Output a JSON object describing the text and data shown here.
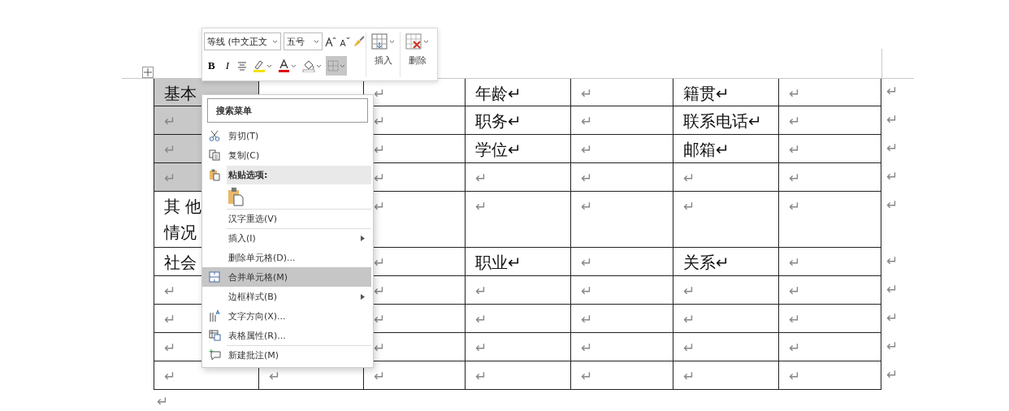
{
  "toolbar": {
    "font_name": "等线 (中文正文",
    "font_size": "五号",
    "format_buttons": [
      {
        "kind": "bold",
        "label": "B",
        "selected": false
      },
      {
        "kind": "italic",
        "label": "I",
        "selected": false
      },
      {
        "kind": "center",
        "selected": false
      },
      {
        "kind": "highlight",
        "selected": false
      },
      {
        "kind": "font-color",
        "selected": false
      },
      {
        "kind": "shading",
        "selected": false
      },
      {
        "kind": "borders",
        "selected": true
      }
    ],
    "table_buttons": [
      {
        "kind": "insert",
        "label": "插入"
      },
      {
        "kind": "delete",
        "label": "删除"
      }
    ]
  },
  "context_menu": {
    "search_placeholder": "搜索菜单",
    "items": [
      {
        "kind": "command",
        "label": "剪切(T)",
        "selected": false,
        "divider_above": false
      },
      {
        "kind": "command",
        "label": "复制(C)",
        "selected": false,
        "divider_above": false
      },
      {
        "kind": "heading",
        "label": "粘贴选项:",
        "selected": false,
        "divider_above": false
      },
      {
        "kind": "paste-buttons",
        "selected": false,
        "divider_above": false
      },
      {
        "kind": "command",
        "label": "汉字重选(V)",
        "selected": false,
        "divider_above": true
      },
      {
        "kind": "submenu",
        "label": "插入(I)",
        "selected": false,
        "divider_above": true
      },
      {
        "kind": "command",
        "label": "删除单元格(D)...",
        "selected": false,
        "divider_above": false
      },
      {
        "kind": "command",
        "label": "合并单元格(M)",
        "selected": true,
        "divider_above": false
      },
      {
        "kind": "submenu",
        "label": "边框样式(B)",
        "selected": false,
        "divider_above": false
      },
      {
        "kind": "command",
        "label": "文字方向(X)...",
        "selected": false,
        "divider_above": false
      },
      {
        "kind": "command",
        "label": "表格属性(R)...",
        "selected": false,
        "divider_above": false
      },
      {
        "kind": "command",
        "label": "新建批注(M)",
        "selected": false,
        "divider_above": true
      }
    ]
  },
  "table": {
    "rows": [
      {
        "tall": false,
        "end_mark": "↵",
        "cells": [
          {
            "text": "基本",
            "selected": true
          },
          {},
          {
            "text": "↵",
            "selected": false
          },
          {
            "text": "年龄↵",
            "selected": false
          },
          {
            "text": "↵",
            "selected": false
          },
          {
            "text": "籍贯↵",
            "selected": false
          },
          {
            "text": "↵",
            "selected": false
          }
        ]
      },
      {
        "tall": false,
        "end_mark": "↵",
        "cells": [
          {
            "text": "↵",
            "selected": true
          },
          {},
          {
            "text": "↵",
            "selected": false
          },
          {
            "text": "职务↵",
            "selected": false
          },
          {
            "text": "↵",
            "selected": false
          },
          {
            "text": "联系电话↵",
            "selected": false
          },
          {
            "text": "↵",
            "selected": false
          }
        ]
      },
      {
        "tall": false,
        "end_mark": "↵",
        "cells": [
          {
            "text": "↵",
            "selected": true
          },
          {},
          {
            "text": "↵",
            "selected": false
          },
          {
            "text": "学位↵",
            "selected": false
          },
          {
            "text": "↵",
            "selected": false
          },
          {
            "text": "邮箱↵",
            "selected": false
          },
          {
            "text": "↵",
            "selected": false
          }
        ]
      },
      {
        "tall": false,
        "end_mark": "↵",
        "cells": [
          {
            "text": "↵",
            "selected": true
          },
          {},
          {
            "text": "↵",
            "selected": false
          },
          {
            "text": "↵",
            "selected": false
          },
          {
            "text": "↵",
            "selected": false
          },
          {
            "text": "↵",
            "selected": false
          },
          {
            "text": "↵",
            "selected": false
          }
        ]
      },
      {
        "tall": true,
        "end_mark": "↵",
        "cells": [
          {
            "lines": [
              "其 他",
              "情况"
            ],
            "selected": false
          },
          {},
          {
            "text": "↵",
            "selected": false
          },
          {
            "text": "↵",
            "selected": false
          },
          {
            "text": "↵",
            "selected": false
          },
          {
            "text": "↵",
            "selected": false
          },
          {
            "text": "↵",
            "selected": false
          }
        ]
      },
      {
        "tall": false,
        "end_mark": "↵",
        "cells": [
          {
            "text": "社会",
            "selected": false
          },
          {},
          {
            "text": "↵",
            "selected": false
          },
          {
            "text": "职业↵",
            "selected": false
          },
          {
            "text": "↵",
            "selected": false
          },
          {
            "text": "关系↵",
            "selected": false
          },
          {
            "text": "↵",
            "selected": false
          }
        ]
      },
      {
        "tall": false,
        "end_mark": "↵",
        "cells": [
          {
            "text": "↵",
            "selected": false
          },
          {},
          {
            "text": "↵",
            "selected": false
          },
          {
            "text": "↵",
            "selected": false
          },
          {
            "text": "↵",
            "selected": false
          },
          {
            "text": "↵",
            "selected": false
          },
          {
            "text": "↵",
            "selected": false
          }
        ]
      },
      {
        "tall": false,
        "end_mark": "↵",
        "cells": [
          {
            "text": "↵",
            "selected": false
          },
          {},
          {
            "text": "↵",
            "selected": false
          },
          {
            "text": "↵",
            "selected": false
          },
          {
            "text": "↵",
            "selected": false
          },
          {
            "text": "↵",
            "selected": false
          },
          {
            "text": "↵",
            "selected": false
          }
        ]
      },
      {
        "tall": false,
        "end_mark": "↵",
        "cells": [
          {
            "text": "↵",
            "selected": false
          },
          {},
          {
            "text": "↵",
            "selected": false
          },
          {
            "text": "↵",
            "selected": false
          },
          {
            "text": "↵",
            "selected": false
          },
          {
            "text": "↵",
            "selected": false
          },
          {
            "text": "↵",
            "selected": false
          }
        ]
      },
      {
        "tall": false,
        "end_mark": "↵",
        "cells": [
          {
            "text": "↵",
            "selected": false
          },
          {
            "text": "↵",
            "selected": false
          },
          {
            "text": "↵",
            "selected": false
          },
          {
            "text": "↵",
            "selected": false
          },
          {
            "text": "↵",
            "selected": false
          },
          {
            "text": "↵",
            "selected": false
          },
          {
            "text": "↵",
            "selected": false
          }
        ]
      }
    ]
  },
  "paragraph_mark": "↵"
}
